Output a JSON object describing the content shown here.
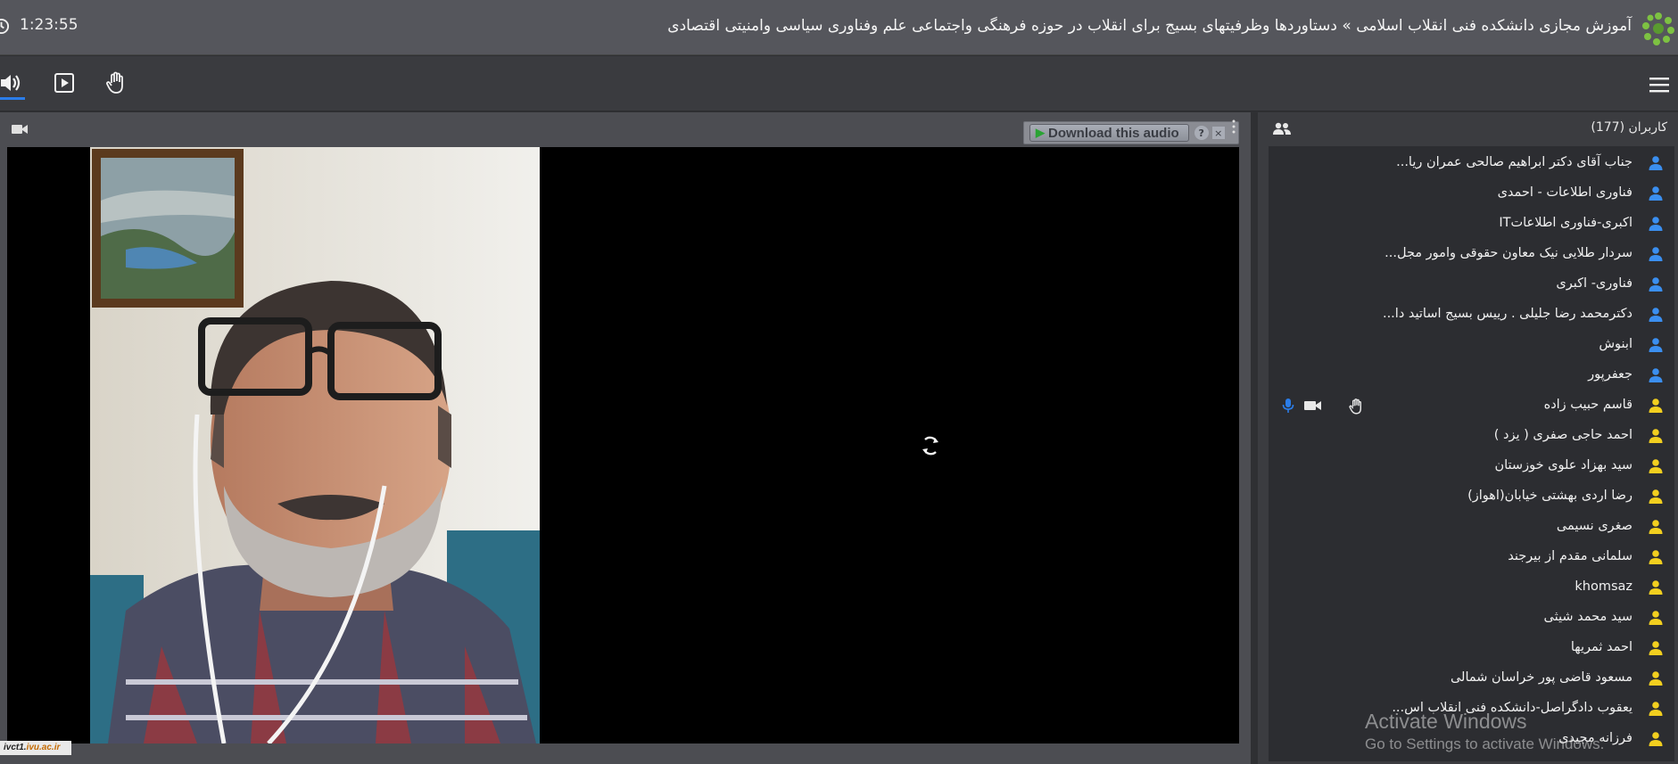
{
  "titlebar": {
    "timer": "1:23:55",
    "title": "آموزش مجازی دانشکده فنی انقلاب اسلامی » دستاوردها وظرفیتهای بسیج برای انقلاب در حوزه فرهنگی واجتماعی علم وفناوری سیاسی وامنیتی اقتصادی"
  },
  "toolbar": {
    "icons": [
      "speaker-icon",
      "screen-share-icon",
      "raise-hand-icon",
      "hamburger-menu-icon"
    ]
  },
  "video": {
    "download_label": "Download this audio",
    "help_label": "?",
    "close_label": "×",
    "watermark_prefix": "ivct1.",
    "watermark_domain": "ivu.ac.ir"
  },
  "users": {
    "title": "کاربران (177)",
    "items": [
      {
        "name": "جناب آقای دکتر ابراهیم صالحی عمران ریا...",
        "role": "presenter"
      },
      {
        "name": "فناوری اطلاعات - احمدی",
        "role": "presenter"
      },
      {
        "name": "اکبری-فناوری اطلاعاتIT",
        "role": "presenter"
      },
      {
        "name": "سردار طلایی نیک معاون حقوقی وامور مجل...",
        "role": "presenter"
      },
      {
        "name": "فناوری- اکبری",
        "role": "presenter"
      },
      {
        "name": "دکترمحمد رضا جلیلی . رییس بسیج اساتید دا...",
        "role": "presenter"
      },
      {
        "name": "ابنوش",
        "role": "presenter"
      },
      {
        "name": "جعفرپور",
        "role": "presenter"
      },
      {
        "name": "قاسم حبیب زاده",
        "role": "participant",
        "controls": true
      },
      {
        "name": "احمد حاجی صفری ( یزد )",
        "role": "participant"
      },
      {
        "name": "سید بهزاد علوی خوزستان",
        "role": "participant"
      },
      {
        "name": "رضا اردی بهشتی خیابان(اهواز)",
        "role": "participant"
      },
      {
        "name": "صغری نسیمی",
        "role": "participant"
      },
      {
        "name": "سلمانی مقدم از بیرجند",
        "role": "participant"
      },
      {
        "name": "khomsaz",
        "role": "participant"
      },
      {
        "name": "سید محمد شیثی",
        "role": "participant"
      },
      {
        "name": "احمد ثمریها",
        "role": "participant"
      },
      {
        "name": "مسعود قاضی پور خراسان شمالی",
        "role": "participant"
      },
      {
        "name": "یعقوب دادگراصل-دانشکده فنی انقلاب اس...",
        "role": "participant"
      },
      {
        "name": "فرزانه مجیدی",
        "role": "participant"
      }
    ]
  },
  "windows_overlay": {
    "line1": "Activate Windows",
    "line2": "Go to Settings to activate Windows."
  },
  "colors": {
    "accent_blue": "#2b7de9",
    "presenter_icon": "#3b8ff0",
    "participant_icon": "#f2cf1f",
    "titlebar_bg": "#55565c",
    "panel_bg": "#3b3c40"
  }
}
